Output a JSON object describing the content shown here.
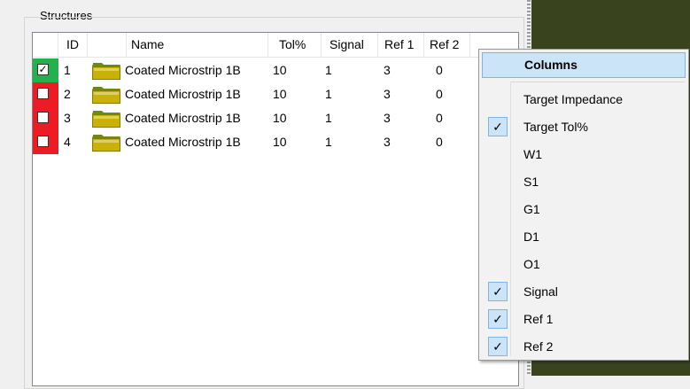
{
  "group": {
    "title": "Structures"
  },
  "table": {
    "headers": {
      "id": "ID",
      "name": "Name",
      "tol": "Tol%",
      "signal": "Signal",
      "ref1": "Ref 1",
      "ref2": "Ref 2"
    },
    "rows": [
      {
        "id": "1",
        "name": "Coated Microstrip 1B",
        "tol": "10",
        "signal": "1",
        "ref1": "3",
        "ref2": "0",
        "checked": true,
        "status_color": "#22b14c"
      },
      {
        "id": "2",
        "name": "Coated Microstrip 1B",
        "tol": "10",
        "signal": "1",
        "ref1": "3",
        "ref2": "0",
        "checked": false,
        "status_color": "#ed1c24"
      },
      {
        "id": "3",
        "name": "Coated Microstrip 1B",
        "tol": "10",
        "signal": "1",
        "ref1": "3",
        "ref2": "0",
        "checked": false,
        "status_color": "#ed1c24"
      },
      {
        "id": "4",
        "name": "Coated Microstrip 1B",
        "tol": "10",
        "signal": "1",
        "ref1": "3",
        "ref2": "0",
        "checked": false,
        "status_color": "#ed1c24"
      }
    ]
  },
  "menu": {
    "header": "Columns",
    "items": [
      {
        "label": "Target Impedance",
        "checked": false
      },
      {
        "label": "Target Tol%",
        "checked": true
      },
      {
        "label": "W1",
        "checked": false
      },
      {
        "label": "S1",
        "checked": false
      },
      {
        "label": "G1",
        "checked": false
      },
      {
        "label": "D1",
        "checked": false
      },
      {
        "label": "O1",
        "checked": false
      },
      {
        "label": "Signal",
        "checked": true
      },
      {
        "label": "Ref 1",
        "checked": true
      },
      {
        "label": "Ref 2",
        "checked": true
      }
    ]
  },
  "colors": {
    "panel": "#39441f",
    "menu_highlight": "#cce4f7"
  },
  "icons": {
    "row_icon": "folder-icon",
    "check_mark": "✓"
  }
}
